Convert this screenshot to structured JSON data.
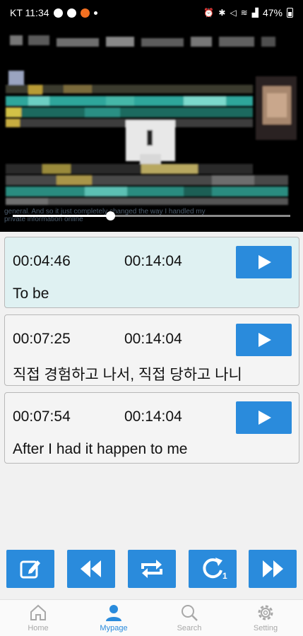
{
  "status_bar": {
    "carrier_time": "KT 11:34",
    "battery_percent": "47%"
  },
  "video": {
    "caption_line1": "general. And so it just completely changed the way I handled my",
    "caption_line2": "private information online",
    "playback_fraction": 0.35
  },
  "bookmarks": [
    {
      "start": "00:04:46",
      "end": "00:14:04",
      "text": "To be",
      "active": true
    },
    {
      "start": "00:07:25",
      "end": "00:14:04",
      "text": "직접 경험하고 나서, 직접 당하고 나니",
      "active": false
    },
    {
      "start": "00:07:54",
      "end": "00:14:04",
      "text": "After I had it happen to me",
      "active": false
    }
  ],
  "controls": {
    "items": [
      "edit-icon",
      "rewind-icon",
      "repeat-icon",
      "replay-one-icon",
      "fast-forward-icon"
    ],
    "replay_badge": "1"
  },
  "nav": {
    "home": "Home",
    "mypage": "Mypage",
    "search": "Search",
    "setting": "Setting",
    "active": "mypage"
  },
  "colors": {
    "accent": "#2a8bdc",
    "active_card": "#dff1f2",
    "nav_inactive": "#a8a8a8"
  }
}
